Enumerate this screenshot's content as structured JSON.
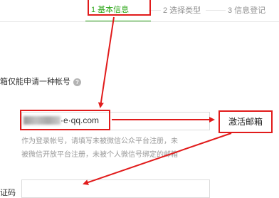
{
  "steps": [
    {
      "label": "1 基本信息"
    },
    {
      "label": "2 选择类型"
    },
    {
      "label": "3 信息登记"
    }
  ],
  "form": {
    "notice_text": "箱仅能申请一种帐号",
    "help_icon_glyph": "?",
    "email_value": "·e·qq.com",
    "activate_button_label": "激活邮箱",
    "hint_line1": "作为登录帐号，请填写未被微信公众平台注册，未",
    "hint_line2": "被微信开放平台注册，未被个人微信号绑定的邮箱",
    "code_label": "证码",
    "code_value": ""
  },
  "colors": {
    "accent_green": "#2aa515",
    "annotation_red": "#e11b1b",
    "muted_text": "#9a9a9a"
  },
  "icons": {
    "help": "question-circle-icon"
  }
}
